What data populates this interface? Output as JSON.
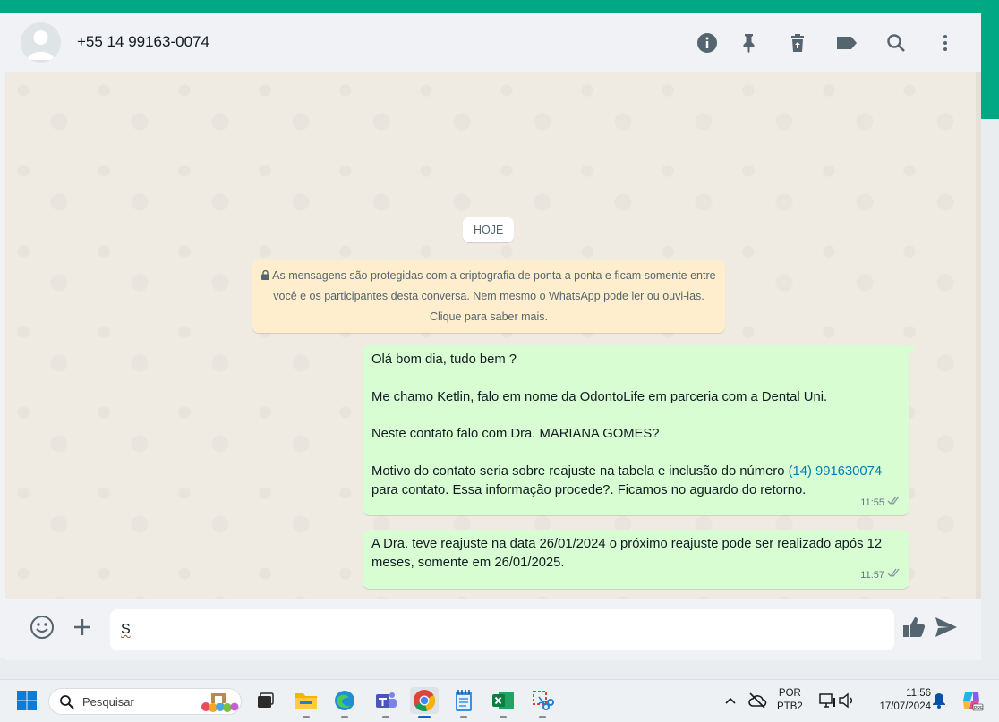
{
  "header": {
    "contact": "+55 14 99163-0074",
    "icons": [
      "info-icon",
      "pin-icon",
      "delete-icon",
      "label-icon",
      "search-icon",
      "menu-icon"
    ]
  },
  "chat": {
    "date_pill": "HOJE",
    "encryption_notice": "As mensagens são protegidas com a criptografia de ponta a ponta e ficam somente entre você e os participantes desta conversa. Nem mesmo o WhatsApp pode ler ou ouvi-las. Clique para saber mais.",
    "messages": [
      {
        "line1": "Olá bom dia, tudo bem ?",
        "line2": "Me chamo Ketlin, falo em nome da OdontoLife em parceria com a Dental Uni.",
        "line3": "Neste contato falo com Dra. MARIANA GOMES?",
        "line4_before": "Motivo do contato seria sobre reajuste na tabela e inclusão do número ",
        "line4_link": "(14) 991630074",
        "line4_after": " para contato. Essa informação procede?. Ficamos no aguardo do retorno.",
        "time": "11:55"
      },
      {
        "text": "A Dra. teve reajuste na data 26/01/2024 o próximo reajuste pode ser realizado após 12 meses, somente em 26/01/2025.",
        "time": "11:57"
      }
    ]
  },
  "composer": {
    "value": "S"
  },
  "taskbar": {
    "search_label": "Pesquisar",
    "lang": "POR",
    "layout": "PTB2",
    "time": "11:56",
    "date": "17/07/2024"
  },
  "colors": {
    "accent": "#00a884",
    "outgoing_bubble": "#d9fdd3",
    "notice_bg": "#ffeecd",
    "link": "#027eb5"
  }
}
